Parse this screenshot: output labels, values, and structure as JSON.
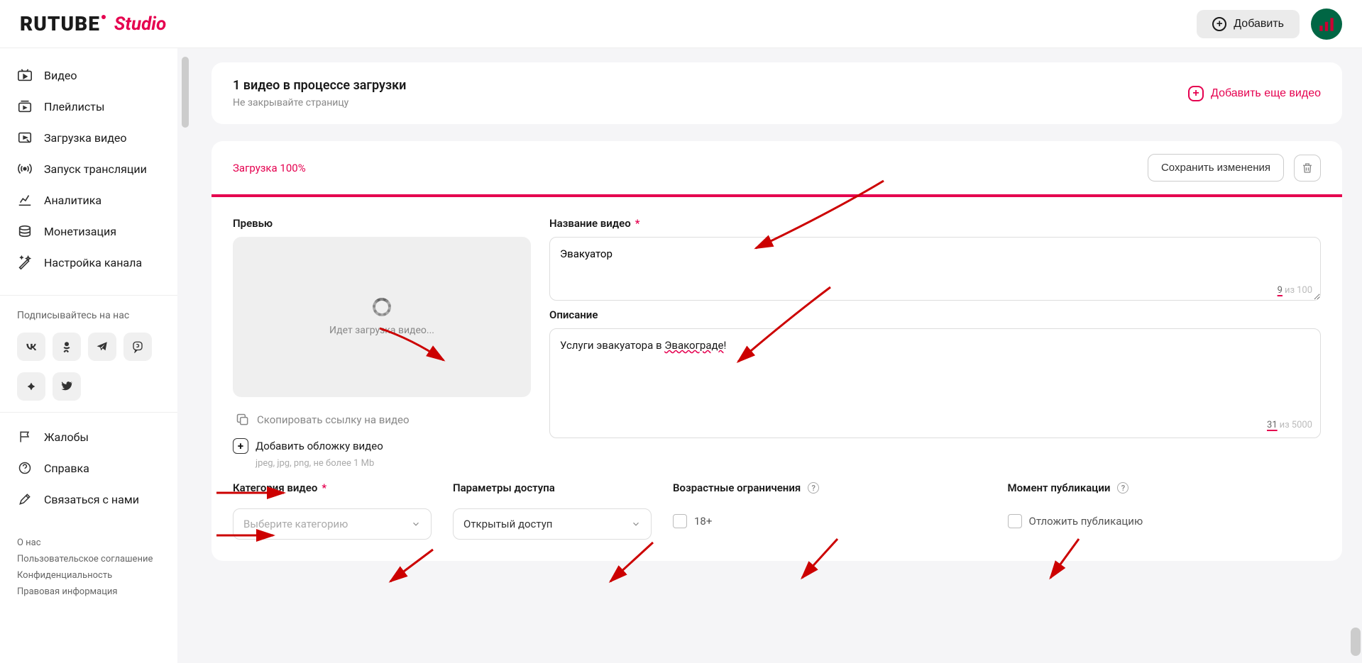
{
  "header": {
    "logo_main": "RUTUBE",
    "logo_sub": "Studio",
    "add_button": "Добавить"
  },
  "sidebar": {
    "items": [
      {
        "id": "videos",
        "label": "Видео"
      },
      {
        "id": "playlists",
        "label": "Плейлисты"
      },
      {
        "id": "upload",
        "label": "Загрузка видео"
      },
      {
        "id": "stream",
        "label": "Запуск трансляции"
      },
      {
        "id": "analytics",
        "label": "Аналитика"
      },
      {
        "id": "monetization",
        "label": "Монетизация"
      },
      {
        "id": "channel-settings",
        "label": "Настройка канала"
      }
    ],
    "subscribe_label": "Подписывайтесь на нас",
    "support_items": [
      {
        "id": "complaints",
        "label": "Жалобы"
      },
      {
        "id": "help",
        "label": "Справка"
      },
      {
        "id": "contact",
        "label": "Связаться с нами"
      }
    ],
    "footer": [
      "О нас",
      "Пользовательское соглашение",
      "Конфиденциальность",
      "Правовая информация"
    ]
  },
  "upload_banner": {
    "title": "1 видео в процессе загрузки",
    "subtitle": "Не закрывайте страницу",
    "add_more": "Добавить еще видео"
  },
  "editor": {
    "status": "Загрузка 100%",
    "save_label": "Сохранить изменения",
    "preview_label": "Превью",
    "preview_loading": "Идет загрузка видео...",
    "copy_link": "Скопировать ссылку на видео",
    "add_cover": "Добавить обложку видео",
    "cover_hint": "jpeg, jpg, png, не более 1 Mb",
    "title_label": "Название видео",
    "title_value": "Эвакуатор",
    "title_count": "9",
    "title_max": "100",
    "desc_label": "Описание",
    "desc_value_prefix": "Услуги эвакуатора в ",
    "desc_value_word": "Эвакограде",
    "desc_value_suffix": "!",
    "desc_count": "31",
    "desc_max": "5000",
    "count_sep": "из",
    "category_label": "Категория видео",
    "category_placeholder": "Выберите категорию",
    "access_label": "Параметры доступа",
    "access_value": "Открытый доступ",
    "age_label": "Возрастные ограничения",
    "age_checkbox": "18+",
    "publish_label": "Момент публикации",
    "publish_checkbox": "Отложить публикацию"
  }
}
